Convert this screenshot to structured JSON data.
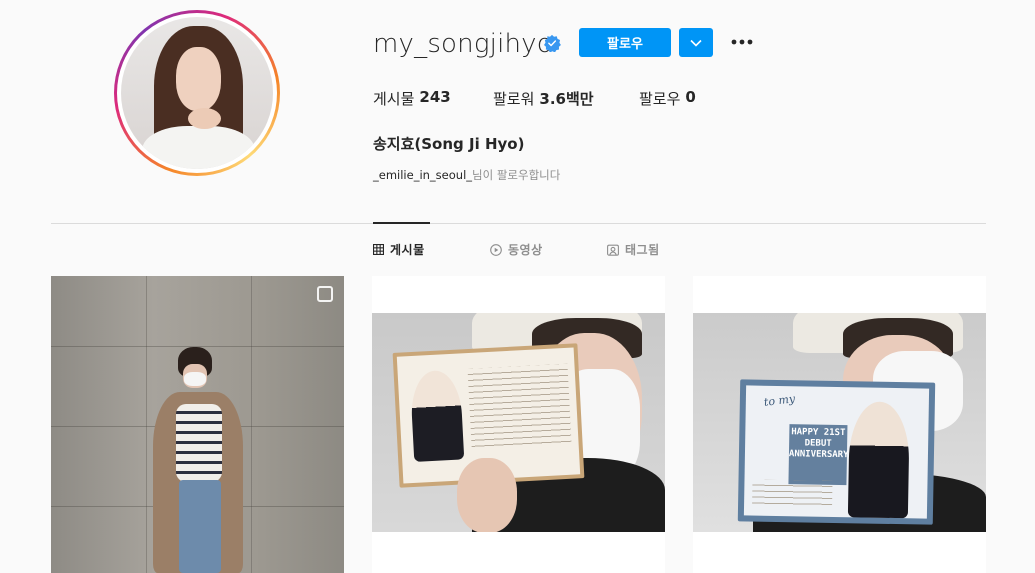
{
  "profile": {
    "username": "my_songjihyo",
    "verified": true,
    "follow_label": "팔로우",
    "dropdown_icon": "chevron-down-icon",
    "more_icon": "more-options-icon",
    "stats": {
      "posts_label": "게시물",
      "posts_value": "243",
      "followers_label": "팔로워",
      "followers_value": "3.6백만",
      "following_label": "팔로우",
      "following_value": "0"
    },
    "full_name": "송지효(Song Ji Hyo)",
    "followed_by_account": "_emilie_in_seoul_",
    "followed_by_suffix": "님이 팔로우합니다"
  },
  "tabs": [
    {
      "label": "게시물",
      "icon": "grid-icon",
      "active": true
    },
    {
      "label": "동영상",
      "icon": "video-icon",
      "active": false
    },
    {
      "label": "태그됨",
      "icon": "tagged-icon",
      "active": false
    }
  ],
  "posts": {
    "post1": {
      "multi_icon": "multiple-photos-icon"
    },
    "post3": {
      "banner_text": "HAPPY 21ST DEBUT ANNIVERSARY!"
    }
  },
  "colors": {
    "accent": "#0095f6",
    "text": "#262626",
    "muted": "#8e8e8e",
    "divider": "#dbdbdb",
    "background": "#fafafa"
  }
}
